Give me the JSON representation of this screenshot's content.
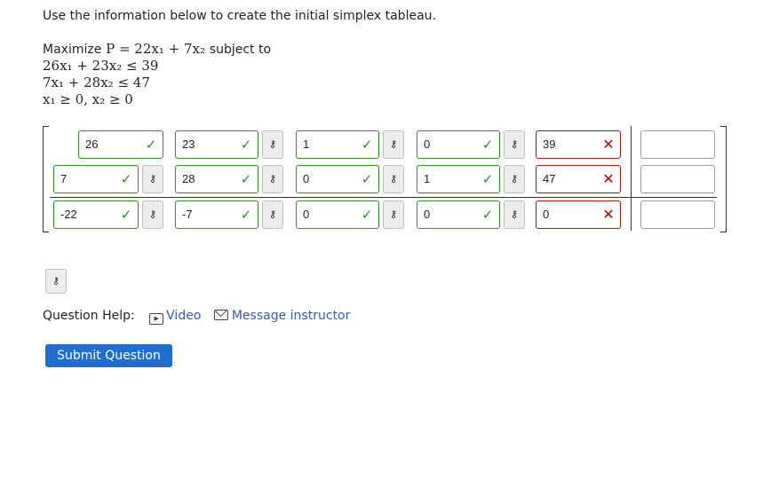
{
  "prompt": "Use the information below to create the initial simplex tableau.",
  "problem": {
    "maximize_label": "Maximize",
    "objective": "P = 22x₁ + 7x₂",
    "subject_to_label": "subject to",
    "constraints": [
      "26x₁ + 23x₂ ≤ 39",
      "7x₁ + 28x₂ ≤ 47",
      "x₁ ≥ 0, x₂ ≥ 0"
    ]
  },
  "tableau": {
    "rows": [
      {
        "cells": [
          {
            "value": "26",
            "status": "correct"
          },
          {
            "value": "23",
            "status": "correct"
          },
          {
            "value": "1",
            "status": "correct"
          },
          {
            "value": "0",
            "status": "correct"
          },
          {
            "value": "39",
            "status": "incorrect"
          },
          {
            "value": "",
            "status": "empty"
          }
        ]
      },
      {
        "cells": [
          {
            "value": "7",
            "status": "correct"
          },
          {
            "value": "28",
            "status": "correct"
          },
          {
            "value": "0",
            "status": "correct"
          },
          {
            "value": "1",
            "status": "correct"
          },
          {
            "value": "47",
            "status": "incorrect"
          },
          {
            "value": "",
            "status": "empty"
          }
        ]
      },
      {
        "cells": [
          {
            "value": "-22",
            "status": "correct"
          },
          {
            "value": "-7",
            "status": "correct"
          },
          {
            "value": "0",
            "status": "correct"
          },
          {
            "value": "0",
            "status": "correct"
          },
          {
            "value": "0",
            "status": "incorrect"
          },
          {
            "value": "",
            "status": "empty"
          }
        ]
      }
    ],
    "correct_mark": "✓",
    "incorrect_mark": "✕",
    "key_icon_glyph": "⚷"
  },
  "help": {
    "label": "Question Help:",
    "video_label": "Video",
    "message_label": "Message instructor",
    "video_icon": "▶"
  },
  "submit_label": "Submit Question",
  "colors": {
    "correct": "#2e8a2e",
    "incorrect": "#c00000",
    "link": "#3060b0",
    "submit_bg": "#1e6fd0"
  }
}
